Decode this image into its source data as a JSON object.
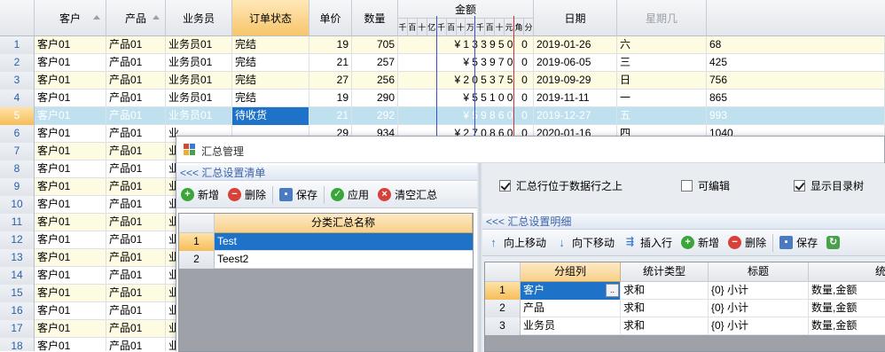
{
  "main_grid": {
    "headers": {
      "customer": "客户",
      "product": "产品",
      "salesman": "业务员",
      "order_status": "订单状态",
      "unit_price": "单价",
      "quantity": "数量",
      "amount": "金额",
      "amount_digits": [
        "千",
        "百",
        "十",
        "亿",
        "千",
        "百",
        "十",
        "万",
        "千",
        "百",
        "十",
        "元",
        "角",
        "分"
      ],
      "date": "日期",
      "weekday": "星期几"
    },
    "rows": [
      {
        "n": "1",
        "customer": "客户01",
        "product": "产品01",
        "salesman": "业务员01",
        "status": "完结",
        "price": "19",
        "qty": "705",
        "amount": "¥133950 0",
        "date": "2019-01-26",
        "weekday": "六",
        "extra": "68"
      },
      {
        "n": "2",
        "customer": "客户01",
        "product": "产品01",
        "salesman": "业务员01",
        "status": "完结",
        "price": "21",
        "qty": "257",
        "amount": "¥53970 0",
        "date": "2019-06-05",
        "weekday": "三",
        "extra": "425"
      },
      {
        "n": "3",
        "customer": "客户01",
        "product": "产品01",
        "salesman": "业务员01",
        "status": "完结",
        "price": "27",
        "qty": "256",
        "amount": "¥205375 0",
        "date": "2019-09-29",
        "weekday": "日",
        "extra": "756"
      },
      {
        "n": "4",
        "customer": "客户01",
        "product": "产品01",
        "salesman": "业务员01",
        "status": "完结",
        "price": "19",
        "qty": "290",
        "amount": "¥55100 0",
        "date": "2019-11-11",
        "weekday": "一",
        "extra": "865"
      },
      {
        "n": "5",
        "customer": "客户01",
        "product": "产品01",
        "salesman": "业务员01",
        "status": "待收货",
        "price": "21",
        "qty": "292",
        "amount": "¥59860 0",
        "date": "2019-12-27",
        "weekday": "五",
        "extra": "993"
      },
      {
        "n": "6",
        "customer": "客户01",
        "product": "产品01",
        "salesman": "业",
        "status": "",
        "price": "29",
        "qty": "934",
        "amount": "¥270860 0",
        "date": "2020-01-16",
        "weekday": "四",
        "extra": "1040"
      },
      {
        "n": "7",
        "customer": "客户01",
        "product": "产品01",
        "salesman": "业"
      },
      {
        "n": "8",
        "customer": "客户01",
        "product": "产品01",
        "salesman": "业"
      },
      {
        "n": "9",
        "customer": "客户01",
        "product": "产品01",
        "salesman": "业"
      },
      {
        "n": "10",
        "customer": "客户01",
        "product": "产品01",
        "salesman": "业"
      },
      {
        "n": "11",
        "customer": "客户01",
        "product": "产品01",
        "salesman": "业"
      },
      {
        "n": "12",
        "customer": "客户01",
        "product": "产品01",
        "salesman": "业"
      },
      {
        "n": "13",
        "customer": "客户01",
        "product": "产品01",
        "salesman": "业"
      },
      {
        "n": "14",
        "customer": "客户01",
        "product": "产品01",
        "salesman": "业"
      },
      {
        "n": "15",
        "customer": "客户01",
        "product": "产品01",
        "salesman": "业"
      },
      {
        "n": "16",
        "customer": "客户01",
        "product": "产品01",
        "salesman": "业"
      },
      {
        "n": "17",
        "customer": "客户01",
        "product": "产品01",
        "salesman": "业"
      },
      {
        "n": "18",
        "customer": "客户01",
        "product": "产品01",
        "salesman": "业"
      }
    ]
  },
  "dialog": {
    "title": "汇总管理",
    "left": {
      "section_title": "<<< 汇总设置清单",
      "toolbar": {
        "add": "新增",
        "delete": "删除",
        "save": "保存",
        "apply": "应用",
        "clear": "清空汇总"
      },
      "grid_header": "分类汇总名称",
      "rows": [
        {
          "n": "1",
          "name": "Test"
        },
        {
          "n": "2",
          "name": "Teest2"
        }
      ]
    },
    "right": {
      "options": {
        "above": "汇总行位于数据行之上",
        "editable": "可编辑",
        "show_tree": "显示目录树"
      },
      "section_title": "<<< 汇总设置明细",
      "toolbar": {
        "up": "向上移动",
        "down": "向下移动",
        "insert": "插入行",
        "add": "新增",
        "delete": "删除",
        "save": "保存"
      },
      "headers": {
        "group": "分组列",
        "stat": "统计类型",
        "title": "标题",
        "col4": "统"
      },
      "rows": [
        {
          "n": "1",
          "group": "客户",
          "stat": "求和",
          "title": "{0} 小计",
          "fields": "数量,金额"
        },
        {
          "n": "2",
          "group": "产品",
          "stat": "求和",
          "title": "{0} 小计",
          "fields": "数量,金额"
        },
        {
          "n": "3",
          "group": "业务员",
          "stat": "求和",
          "title": "{0} 小计",
          "fields": "数量,金额"
        }
      ]
    }
  },
  "colors": {
    "accent": "#1e73c8",
    "header_selected": "#f7c56a",
    "row_alt": "#fdfbe2",
    "row_current": "#bfe0ef"
  }
}
